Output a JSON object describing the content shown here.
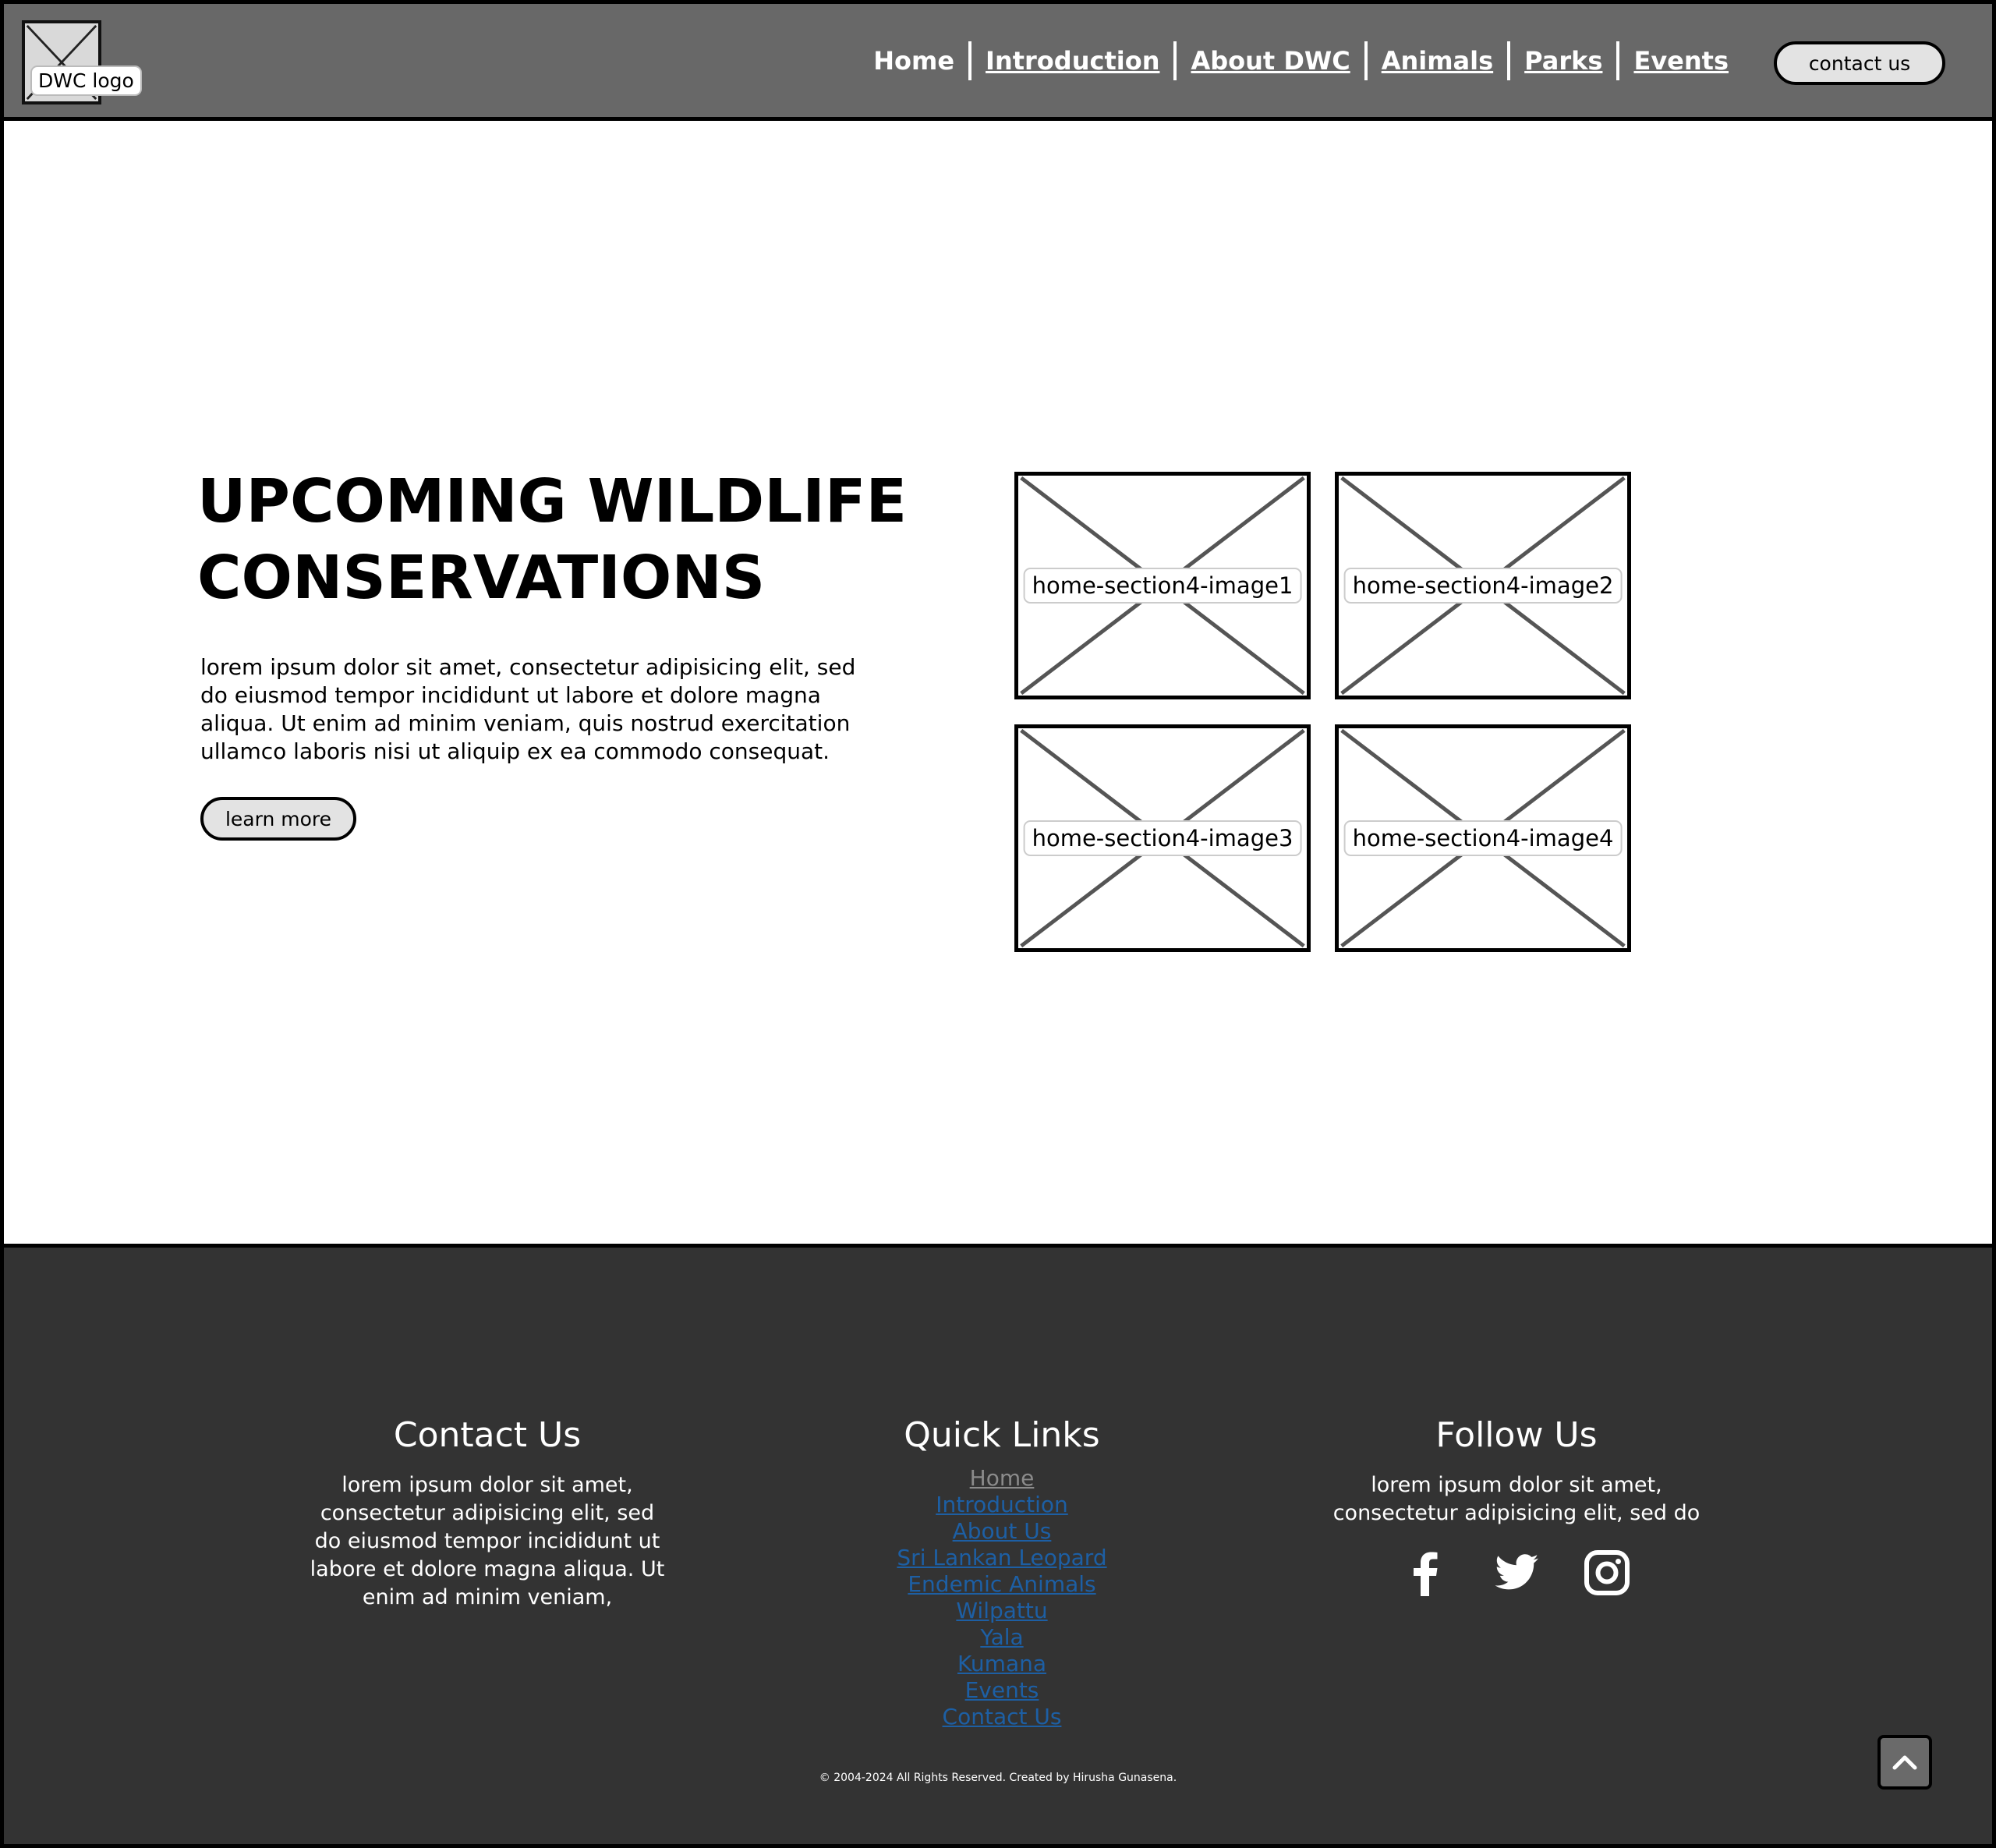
{
  "header": {
    "logo_label": "DWC logo",
    "nav": [
      {
        "label": "Home"
      },
      {
        "label": "Introduction"
      },
      {
        "label": "About DWC"
      },
      {
        "label": "Animals"
      },
      {
        "label": "Parks"
      },
      {
        "label": "Events"
      }
    ],
    "contact_button": "contact us"
  },
  "section": {
    "title_line1": "UPCOMING WILDLIFE",
    "title_line2": "CONSERVATIONS",
    "description": "lorem ipsum dolor sit amet, consectetur adipisicing elit, sed do eiusmod tempor incididunt ut labore et dolore magna aliqua. Ut enim ad minim veniam, quis nostrud exercitation ullamco laboris nisi ut aliquip ex ea commodo consequat.",
    "button": "learn more",
    "images": [
      {
        "label": "home-section4-image1"
      },
      {
        "label": "home-section4-image2"
      },
      {
        "label": "home-section4-image3"
      },
      {
        "label": "home-section4-image4"
      }
    ]
  },
  "footer": {
    "contact": {
      "heading": "Contact Us",
      "text": "lorem ipsum dolor sit amet, consectetur adipisicing elit, sed do eiusmod tempor incididunt ut labore et dolore magna aliqua. Ut enim ad minim veniam,"
    },
    "quick_links": {
      "heading": "Quick Links",
      "links": [
        {
          "label": "Home"
        },
        {
          "label": "Introduction"
        },
        {
          "label": "About Us"
        },
        {
          "label": "Sri Lankan Leopard"
        },
        {
          "label": "Endemic Animals"
        },
        {
          "label": "Wilpattu"
        },
        {
          "label": "Yala"
        },
        {
          "label": "Kumana"
        },
        {
          "label": "Events"
        },
        {
          "label": "Contact Us"
        }
      ]
    },
    "follow": {
      "heading": "Follow Us",
      "text": "lorem ipsum dolor sit amet, consectetur adipisicing elit, sed do",
      "icons": [
        "facebook-icon",
        "twitter-icon",
        "instagram-icon"
      ]
    },
    "copyright": "© 2004-2024 All Rights Reserved. Created by Hirusha Gunasena."
  },
  "colors": {
    "header_bg": "#686868",
    "footer_bg": "#333333",
    "link": "#1d5fa4",
    "button_bg": "#e3e3e3"
  }
}
